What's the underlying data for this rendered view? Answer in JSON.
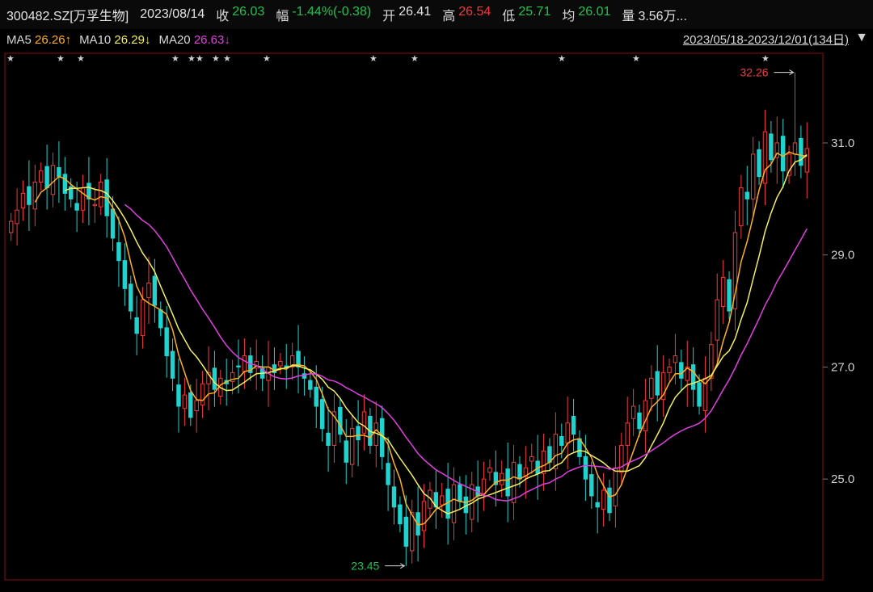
{
  "header": {
    "stock": "300482.SZ[万孚生物]",
    "date": "2023/08/14",
    "close_label": "收",
    "close_value": "26.03",
    "change_label": "幅",
    "change_value": "-1.44%(-0.38)",
    "open_label": "开",
    "open_value": "26.41",
    "high_label": "高",
    "high_value": "26.54",
    "low_label": "低",
    "low_value": "25.71",
    "avg_label": "均",
    "avg_value": "26.01",
    "vol_label": "量",
    "vol_value": "3.56万..."
  },
  "ma": {
    "ma5_label": "MA5",
    "ma5_value": "26.26↑",
    "ma10_label": "MA10",
    "ma10_value": "26.29↓",
    "ma20_label": "MA20",
    "ma20_value": "26.63↓"
  },
  "range_text": "2023/05/18-2023/12/01(134日)",
  "colors": {
    "up": "#f23a3a",
    "down": "#1fd3cf",
    "ma5": "#ffb020",
    "ma10": "#f5f05a",
    "ma20": "#e23ee0",
    "grid": "#3a0a0a"
  },
  "chart_data": {
    "type": "candlestick",
    "count": 134,
    "ylim": [
      23.2,
      32.6
    ],
    "yticks": [
      25.0,
      27.0,
      29.0,
      31.0
    ],
    "max_label": "32.26",
    "min_label": "23.45",
    "closes": [
      29.6,
      29.8,
      30.1,
      29.9,
      30.3,
      30.5,
      30.2,
      30.6,
      30.4,
      30.1,
      30.0,
      29.8,
      30.2,
      30.0,
      29.9,
      30.3,
      29.7,
      29.3,
      28.9,
      28.4,
      28.0,
      27.6,
      28.2,
      28.5,
      28.1,
      27.7,
      27.2,
      26.8,
      26.3,
      26.5,
      26.1,
      26.4,
      26.7,
      26.9,
      26.6,
      26.8,
      26.7,
      26.9,
      27.0,
      27.2,
      26.9,
      27.1,
      26.8,
      27.0,
      26.9,
      27.1,
      27.0,
      27.2,
      27.0,
      26.8,
      26.6,
      26.3,
      25.9,
      25.6,
      26.2,
      25.8,
      25.3,
      25.9,
      25.7,
      26.2,
      25.6,
      26.0,
      25.4,
      24.9,
      24.5,
      24.2,
      23.8,
      24.4,
      24.0,
      24.6,
      24.8,
      24.5,
      24.7,
      24.3,
      24.9,
      24.6,
      24.4,
      24.9,
      24.7,
      25.0,
      25.2,
      24.9,
      25.1,
      24.7,
      25.3,
      25.0,
      25.2,
      25.4,
      25.1,
      25.5,
      25.3,
      25.8,
      25.6,
      26.0,
      25.8,
      25.4,
      25.0,
      24.7,
      24.5,
      24.8,
      24.4,
      25.2,
      25.6,
      26.0,
      26.3,
      25.9,
      26.4,
      26.8,
      26.5,
      26.9,
      27.0,
      27.2,
      26.8,
      27.0,
      26.6,
      26.3,
      26.8,
      27.4,
      28.2,
      28.6,
      28.0,
      29.4,
      30.2,
      30.0,
      30.8,
      30.4,
      31.2,
      30.7,
      31.0,
      30.5,
      30.8,
      31.0,
      30.6,
      30.9
    ],
    "high_index": 131,
    "low_index": 66,
    "high_value": 32.26,
    "low_value": 23.45
  }
}
